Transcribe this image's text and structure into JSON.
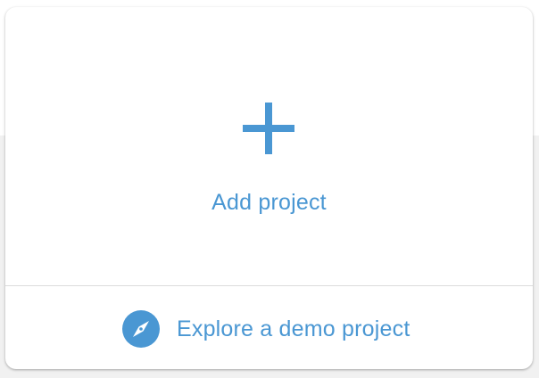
{
  "colors": {
    "accent": "#4a97d3",
    "card_background": "#ffffff",
    "page_background": "#f1f1f1",
    "divider": "#dcdcdc"
  },
  "card": {
    "add_project": {
      "icon": "plus-icon",
      "label": "Add project"
    },
    "demo_project": {
      "icon": "compass-icon",
      "label": "Explore a demo project"
    }
  }
}
